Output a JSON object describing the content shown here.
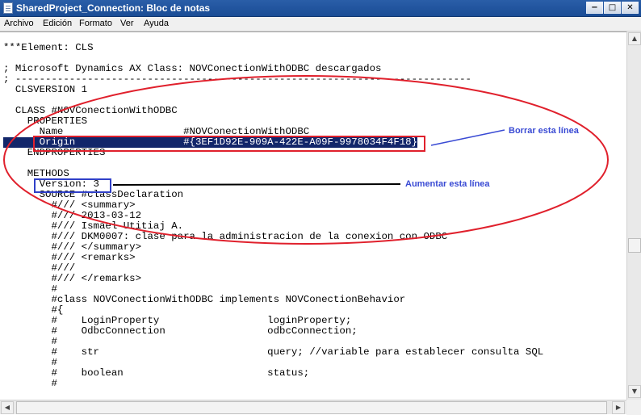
{
  "window": {
    "title": "SharedProject_Connection: Bloc de notas",
    "controls": {
      "minimize": "−",
      "maximize": "□",
      "close": "✕"
    }
  },
  "menu": [
    "Archivo",
    "Edición",
    "Formato",
    "Ver",
    "Ayuda"
  ],
  "editor": {
    "lines": [
      "***Element: CLS",
      "",
      "; Microsoft Dynamics AX Class: NOVConectionWithODBC descargados",
      "; ----------------------------------------------------------------------------",
      "  CLSVERSION 1",
      "",
      "  CLASS #NOVConectionWithODBC",
      "    PROPERTIES",
      "      Name                    #NOVConectionWithODBC",
      "      Origin                  #{3EF1D92E-909A-422E-A09F-9978034F4F18}",
      "    ENDPROPERTIES",
      "",
      "    METHODS",
      "      Version: 3",
      "      SOURCE #classDeclaration",
      "        #/// <summary>",
      "        #/// 2013-03-12",
      "        #/// Ismael Utitiaj A.",
      "        #/// DKM0007: clase para la administracion de la conexion con ODBC",
      "        #/// </summary>",
      "        #/// <remarks>",
      "        #///",
      "        #/// </remarks>",
      "        #",
      "        #class NOVConectionWithODBC implements NOVConectionBehavior",
      "        #{",
      "        #    LoginProperty                  loginProperty;",
      "        #    OdbcConnection                 odbcConnection;",
      "        #",
      "        #    str                            query; //variable para establecer consulta SQL",
      "        #",
      "        #    boolean                        status;",
      "        #"
    ]
  },
  "annotations": {
    "delete_label": "Borrar esta línea",
    "increase_label": "Aumentar esta línea",
    "ellipse_color": "#e0202c",
    "highlight_color": "#e0202c",
    "version_box_color": "#3040c8",
    "arrow_color": "#3a4bd4"
  },
  "scrollbar": {
    "up": "▲",
    "down": "▼",
    "left": "◀",
    "right": "▶"
  }
}
